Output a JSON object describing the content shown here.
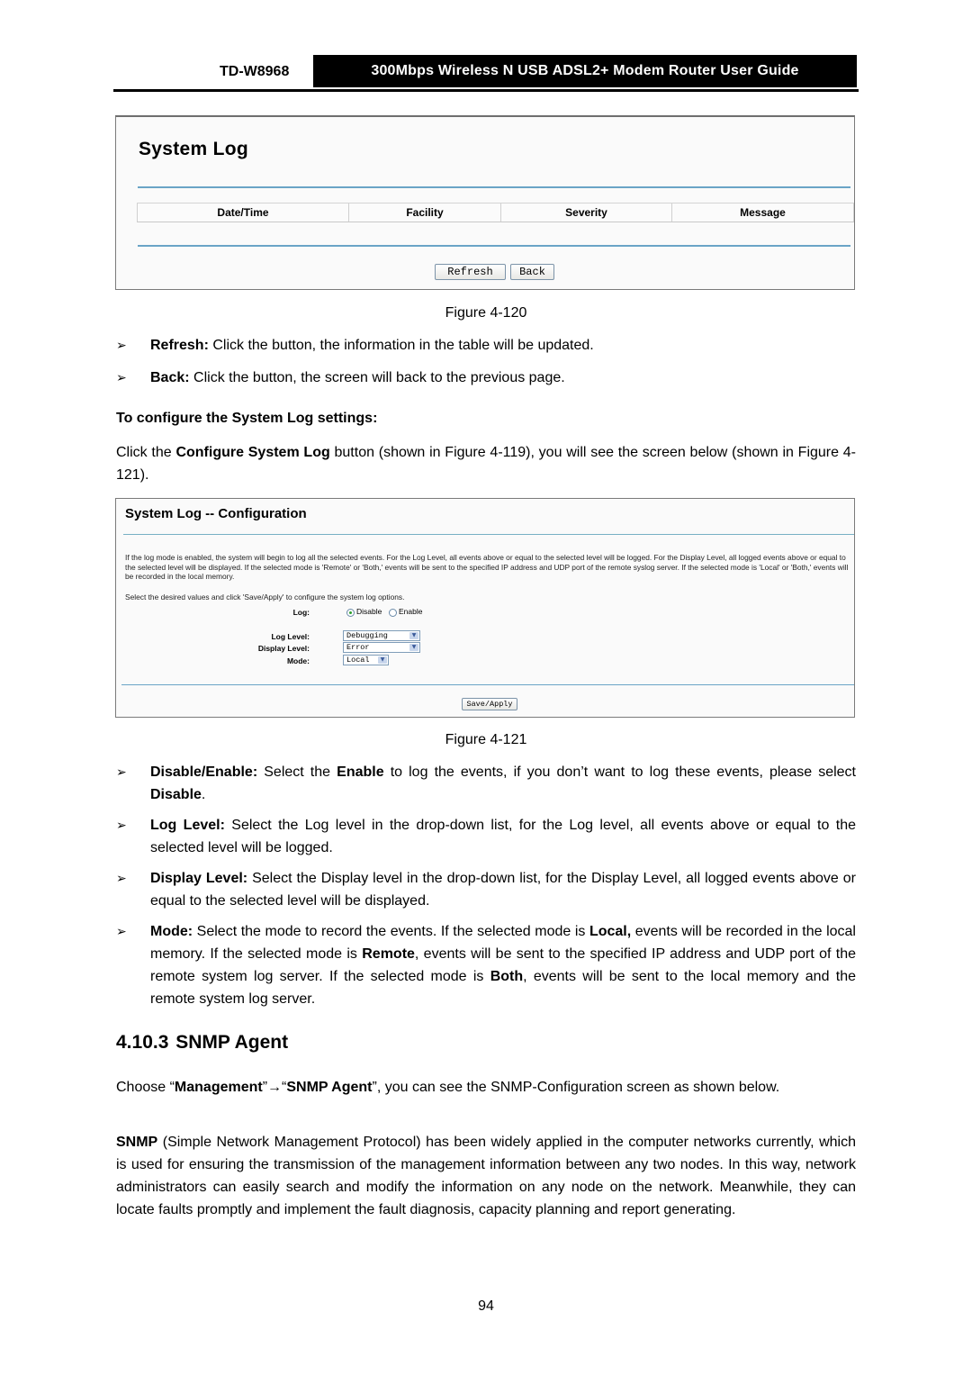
{
  "header": {
    "model": "TD-W8968",
    "title": "300Mbps Wireless N USB ADSL2+ Modem Router User Guide"
  },
  "figure_120": {
    "title": "System Log",
    "columns": [
      "Date/Time",
      "Facility",
      "Severity",
      "Message"
    ],
    "buttons": {
      "refresh": "Refresh",
      "back": "Back"
    },
    "caption": "Figure 4-120"
  },
  "bullets_1": [
    {
      "term": "Refresh:",
      "text": " Click the button, the information in the table will be updated."
    },
    {
      "term": "Back:",
      "text": " Click the button, the screen will back to the previous page."
    }
  ],
  "subheading": "To configure the System Log settings:",
  "intro": {
    "part1": "Click the ",
    "bold": "Configure System Log",
    "part2": " button (shown in Figure 4-119), you will see the screen below (shown in Figure 4-121)."
  },
  "figure_121": {
    "title": "System Log -- Configuration",
    "description": "If the log mode is enabled, the system will begin to log all the selected events. For the Log Level, all events above or equal to the selected level will be logged. For the Display Level, all logged events above or equal to the selected level will be displayed. If the selected mode is 'Remote' or 'Both,' events will be sent to the specified IP address and UDP port of the remote syslog server. If the selected mode is 'Local' or 'Both,' events will be recorded in the local memory.",
    "instruction": "Select the desired values and click 'Save/Apply' to configure the system log options.",
    "log_label": "Log:",
    "log_options": [
      "Disable",
      "Enable"
    ],
    "log_selected": "Disable",
    "log_level_label": "Log Level:",
    "log_level_value": "Debugging",
    "display_level_label": "Display Level:",
    "display_level_value": "Error",
    "mode_label": "Mode:",
    "mode_value": "Local",
    "save_button": "Save/Apply",
    "caption": "Figure 4-121"
  },
  "bullets_2": {
    "disable_enable": {
      "term": "Disable/Enable:",
      "t1": " Select the ",
      "b1": "Enable",
      "t2": " to log the events, if you don’t want to log these events, please select ",
      "b2": "Disable",
      "t3": "."
    },
    "log_level": {
      "term": "Log Level:",
      "text": " Select the Log level in the drop-down list, for the Log level, all events above or equal to the selected level will be logged."
    },
    "display_level": {
      "term": "Display Level:",
      "text": " Select the Display level in the drop-down list, for the Display Level, all logged events above or equal to the selected level will be displayed."
    },
    "mode": {
      "term": "Mode:",
      "t1": " Select the mode to record the events. If the selected mode is ",
      "b1": "Local,",
      "t2": " events will be recorded in the local memory. If the selected mode is ",
      "b2": "Remote",
      "t3": ", events will be sent to the specified IP address and UDP port of the remote system log server. If the selected mode is ",
      "b3": "Both",
      "t4": ", events will be sent to the local memory and the remote system log server."
    }
  },
  "section": {
    "number": "4.10.3",
    "title": "SNMP Agent"
  },
  "snmp_intro": {
    "t1": "Choose “",
    "b1": "Management",
    "t2": "”→“",
    "b2": "SNMP Agent",
    "t3": "”, you can see the SNMP-Configuration screen as shown below."
  },
  "snmp_desc": {
    "b1": "SNMP",
    "t1": " (Simple Network Management Protocol) has been widely applied in the computer networks currently, which is used for ensuring the transmission of the management information between any two nodes. In this way, network administrators can easily search and modify the information on any node on the network. Meanwhile, they can locate faults promptly and implement the fault diagnosis, capacity planning and report generating."
  },
  "page_number": "94",
  "colors": {
    "rule_blue": "#6aa4c6",
    "header_bg": "#000000",
    "radio_selected": "#2ca02c"
  }
}
